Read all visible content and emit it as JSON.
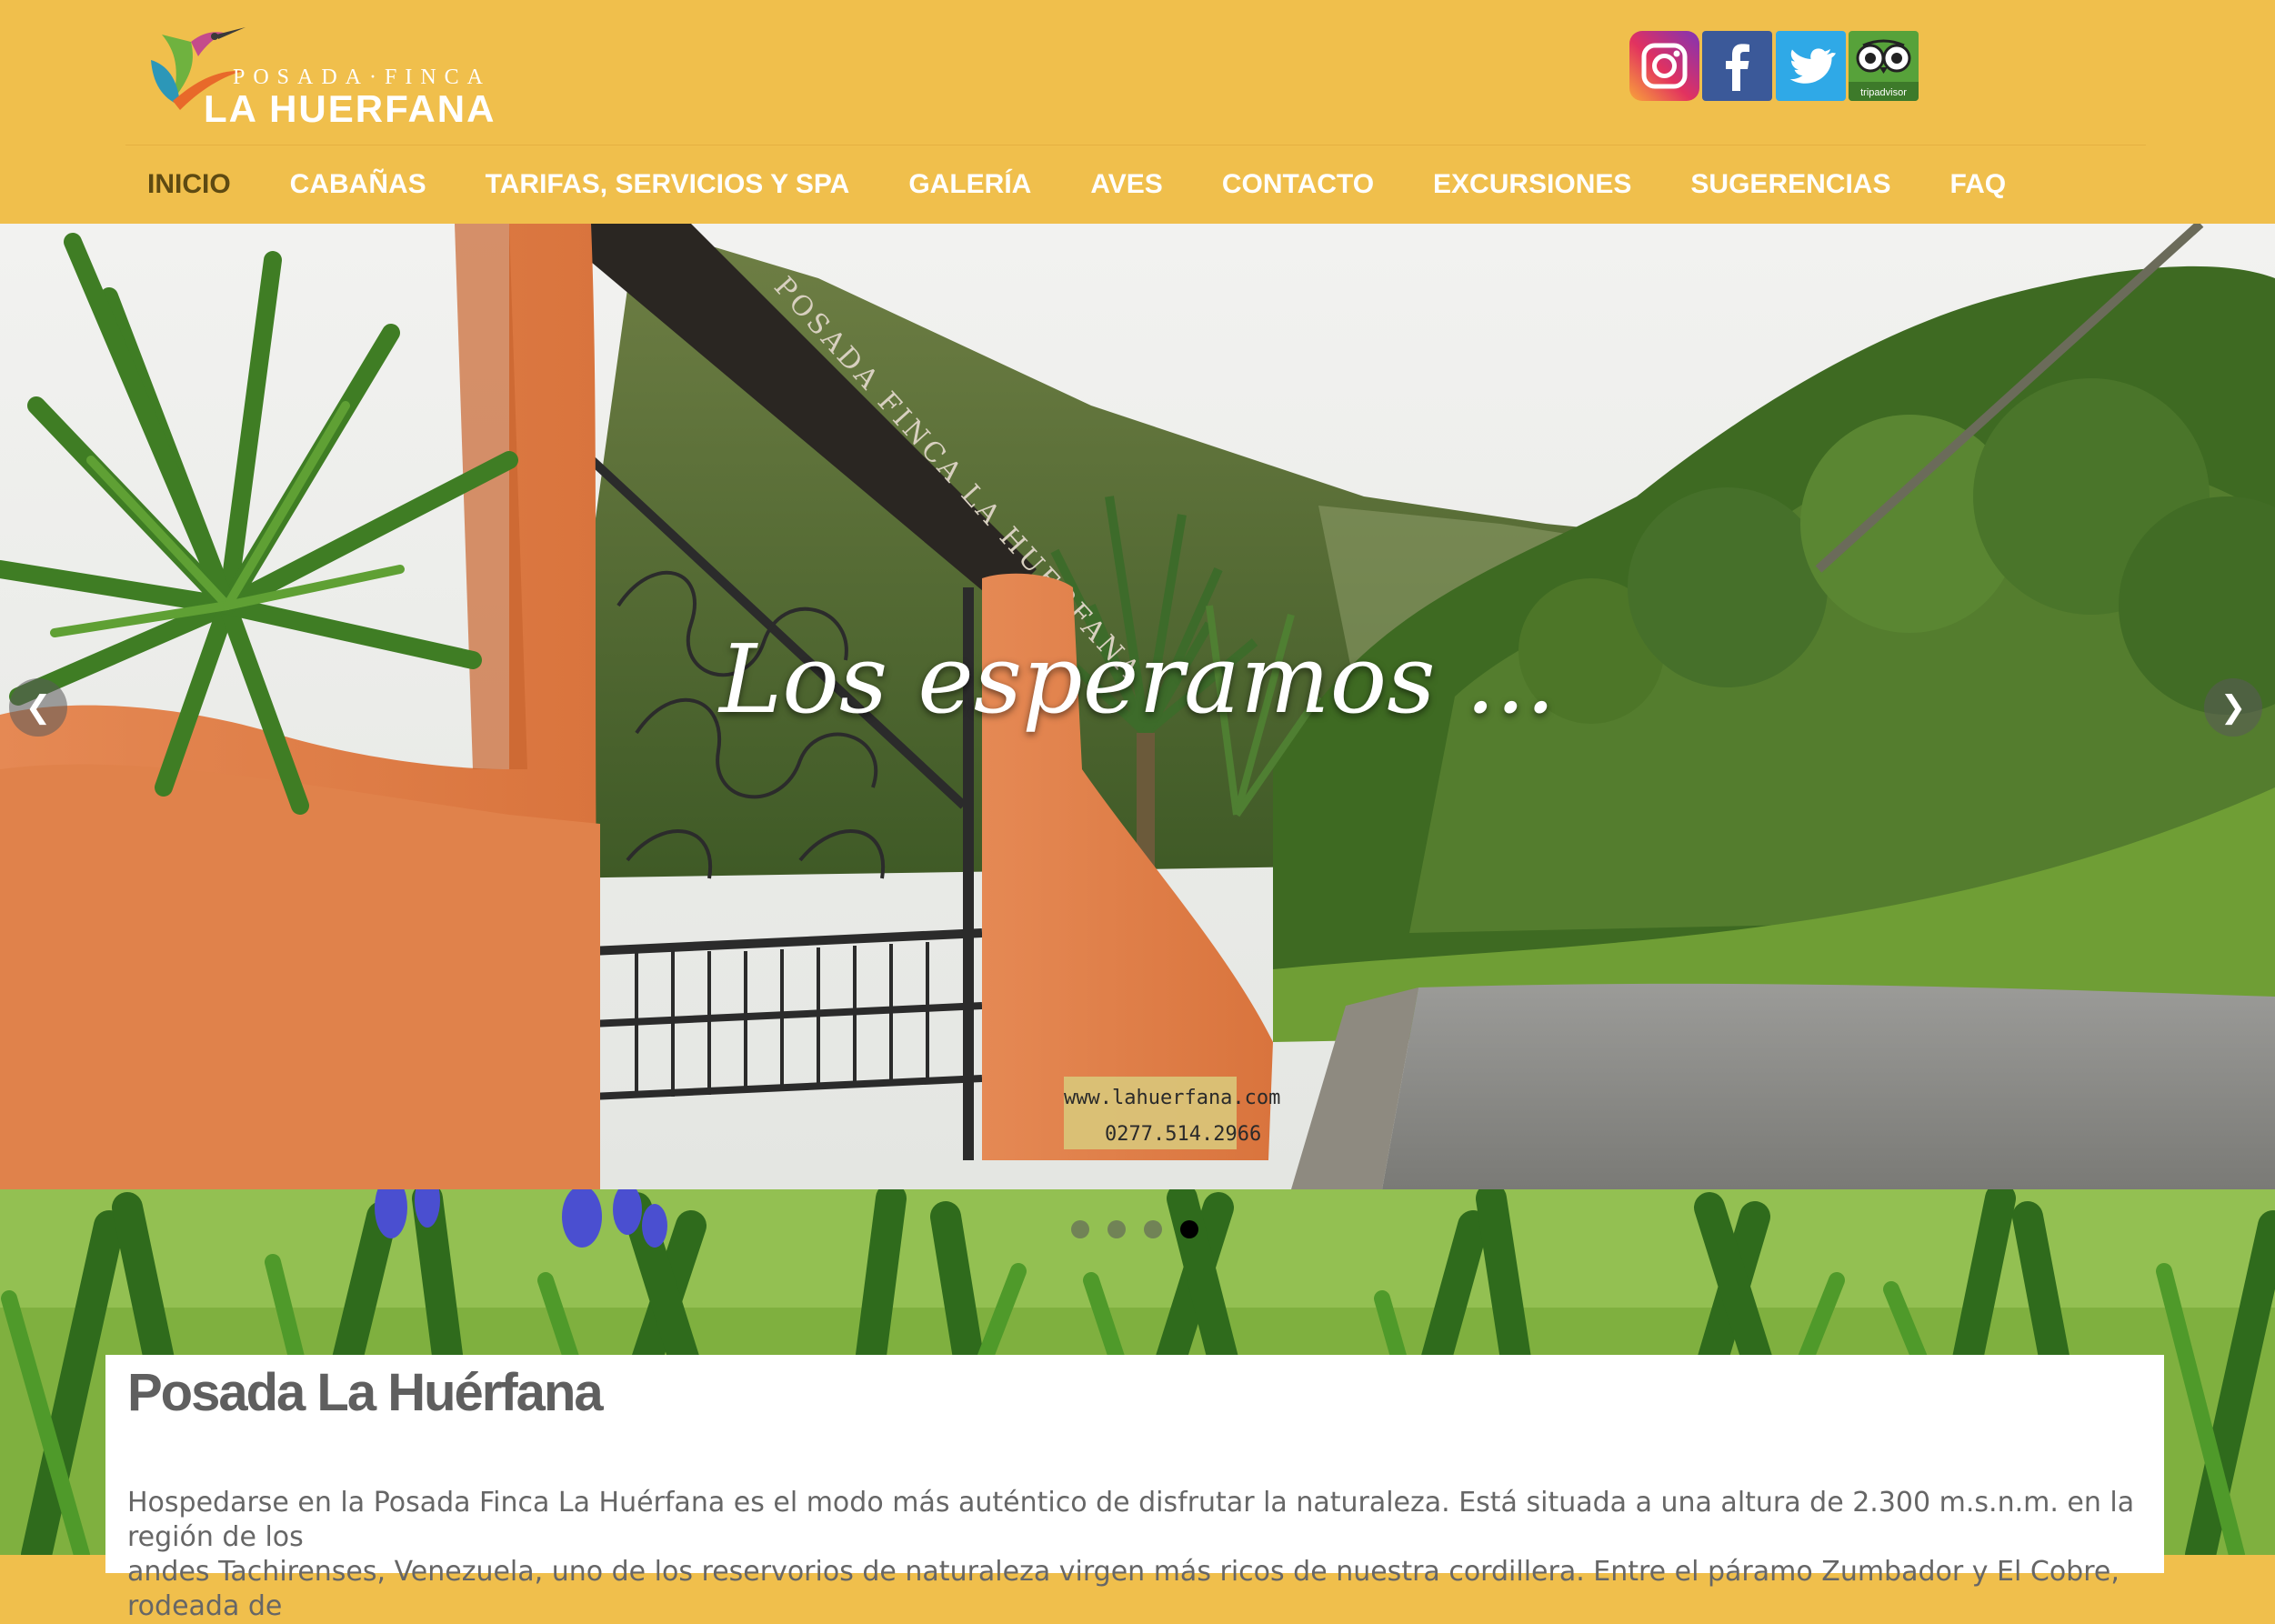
{
  "header": {
    "logo_sub": "POSADA·FINCA",
    "logo_main": "LA HUERFANA",
    "social": [
      {
        "name": "instagram",
        "icon": "instagram-icon"
      },
      {
        "name": "facebook",
        "icon": "facebook-icon"
      },
      {
        "name": "twitter",
        "icon": "twitter-icon"
      },
      {
        "name": "tripadvisor",
        "icon": "tripadvisor-icon",
        "label": "tripadvisor"
      }
    ]
  },
  "nav": [
    {
      "label": "INICIO",
      "active": true
    },
    {
      "label": "CABAÑAS"
    },
    {
      "label": "TARIFAS, SERVICIOS Y SPA"
    },
    {
      "label": "GALERÍA"
    },
    {
      "label": "AVES"
    },
    {
      "label": "CONTACTO"
    },
    {
      "label": "EXCURSIONES"
    },
    {
      "label": "SUGERENCIAS"
    },
    {
      "label": "FAQ"
    }
  ],
  "slider": {
    "caption": "Los esperamos ...",
    "sign_url": "www.lahuerfana.com",
    "sign_phone": "0277.514.2966",
    "gate_sign": "POSADA FINCA LA HUERFANA",
    "prev_icon": "chevron-left-icon",
    "next_icon": "chevron-right-icon",
    "slide_count": 4,
    "active_slide": 4
  },
  "content": {
    "title": "Posada La Huérfana",
    "paragraph_line1": "Hospedarse en la Posada Finca La Huérfana es el modo más auténtico de disfrutar la naturaleza. Está situada a una altura de 2.300 m.s.n.m. en la región de los",
    "paragraph_line2": "andes Tachirenses, Venezuela, uno de los reservorios de naturaleza virgen más ricos de nuestra cordillera. Entre el páramo Zumbador y El Cobre, rodeada de"
  },
  "colors": {
    "header_bg": "#f0bf4c",
    "nav_text": "#ffffff",
    "nav_active": "#5e4a12",
    "title": "#5f5f5f",
    "body_text": "#666666"
  }
}
